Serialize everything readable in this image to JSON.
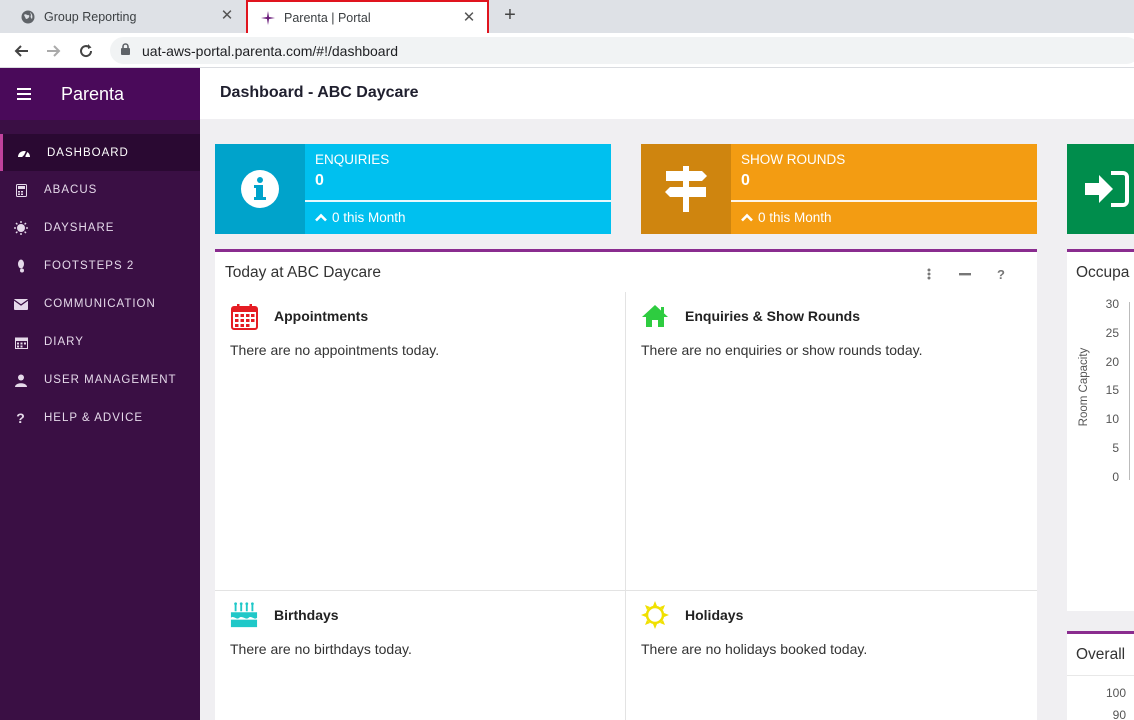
{
  "browser": {
    "tabs": [
      {
        "title": "Group Reporting",
        "favicon": "globe-icon"
      },
      {
        "title": "Parenta | Portal",
        "favicon": "parenta-logo-icon",
        "active": true
      }
    ],
    "url": "uat-aws-portal.parenta.com/#!/dashboard"
  },
  "sidebar": {
    "brand": "Parenta",
    "items": [
      {
        "label": "DASHBOARD",
        "icon": "dashboard-icon",
        "active": true
      },
      {
        "label": "ABACUS",
        "icon": "calculator-icon"
      },
      {
        "label": "DAYSHARE",
        "icon": "sun-icon"
      },
      {
        "label": "FOOTSTEPS 2",
        "icon": "footstep-icon"
      },
      {
        "label": "COMMUNICATION",
        "icon": "envelope-icon"
      },
      {
        "label": "DIARY",
        "icon": "calendar-icon"
      },
      {
        "label": "USER MANAGEMENT",
        "icon": "user-icon"
      },
      {
        "label": "HELP & ADVICE",
        "icon": "question-icon"
      }
    ]
  },
  "header": {
    "title": "Dashboard - ABC Daycare"
  },
  "stats": [
    {
      "label": "ENQUIRIES",
      "value": "0",
      "footer": "0 this Month",
      "color": "#00c0ef",
      "icon": "info-icon"
    },
    {
      "label": "SHOW ROUNDS",
      "value": "0",
      "footer": "0 this Month",
      "color": "#f39c12",
      "icon": "signpost-icon"
    },
    {
      "icon": "sign-in-icon",
      "color": "#00a65a"
    }
  ],
  "today": {
    "title": "Today at ABC Daycare",
    "sections": [
      {
        "title": "Appointments",
        "text": "There are no appointments today.",
        "icon": "calendar-icon",
        "color": "#e51c23"
      },
      {
        "title": "Enquiries & Show Rounds",
        "text": "There are no enquiries or show rounds today.",
        "icon": "home-icon",
        "color": "#2ecc40"
      },
      {
        "title": "Birthdays",
        "text": "There are no birthdays today.",
        "icon": "birthday-cake-icon",
        "color": "#1fc8c8"
      },
      {
        "title": "Holidays",
        "text": "There are no holidays booked today.",
        "icon": "sun-icon",
        "color": "#f0e000"
      }
    ]
  },
  "occupancy": {
    "title": "Occupa",
    "ylabel": "Room Capacity",
    "ticks": [
      "30",
      "25",
      "20",
      "15",
      "10",
      "5",
      "0"
    ]
  },
  "overall": {
    "title": "Overall",
    "ticks": [
      "100",
      "90"
    ]
  }
}
